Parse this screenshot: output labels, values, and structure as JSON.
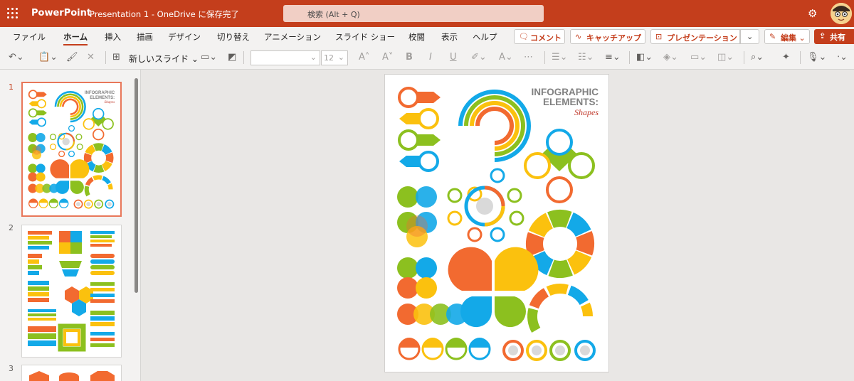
{
  "titlebar": {
    "app_name": "PowerPoint",
    "doc_title": "Presentation 1 - OneDrive に保存完了",
    "search_placeholder": "検索 (Alt + Q)",
    "settings_icon": "gear-icon",
    "avatar_icon": "avatar"
  },
  "ribbon": {
    "tabs": [
      "ファイル",
      "ホーム",
      "挿入",
      "描画",
      "デザイン",
      "切り替え",
      "アニメーション",
      "スライド ショー",
      "校閲",
      "表示",
      "ヘルプ"
    ],
    "active_tab": "ホーム",
    "comment_label": "コメント",
    "catchup_label": "キャッチアップ",
    "present_label": "プレゼンテーション",
    "edit_label": "編集",
    "share_label": "共有",
    "accent": "#c43e1c"
  },
  "toolbar": {
    "new_slide_label": "新しいスライド",
    "font_size": "12"
  },
  "slides": {
    "numbers": [
      "1",
      "2",
      "3"
    ],
    "selected": 1
  },
  "slide": {
    "title_line1": "INFOGRAPHIC",
    "title_line2": "ELEMENTS:",
    "subtitle": "Shapes",
    "colors": {
      "orange": "#f26a30",
      "yellow": "#fbc10e",
      "green": "#8cc01f",
      "blue": "#13a9e8",
      "grey": "#d9d9d9"
    }
  }
}
